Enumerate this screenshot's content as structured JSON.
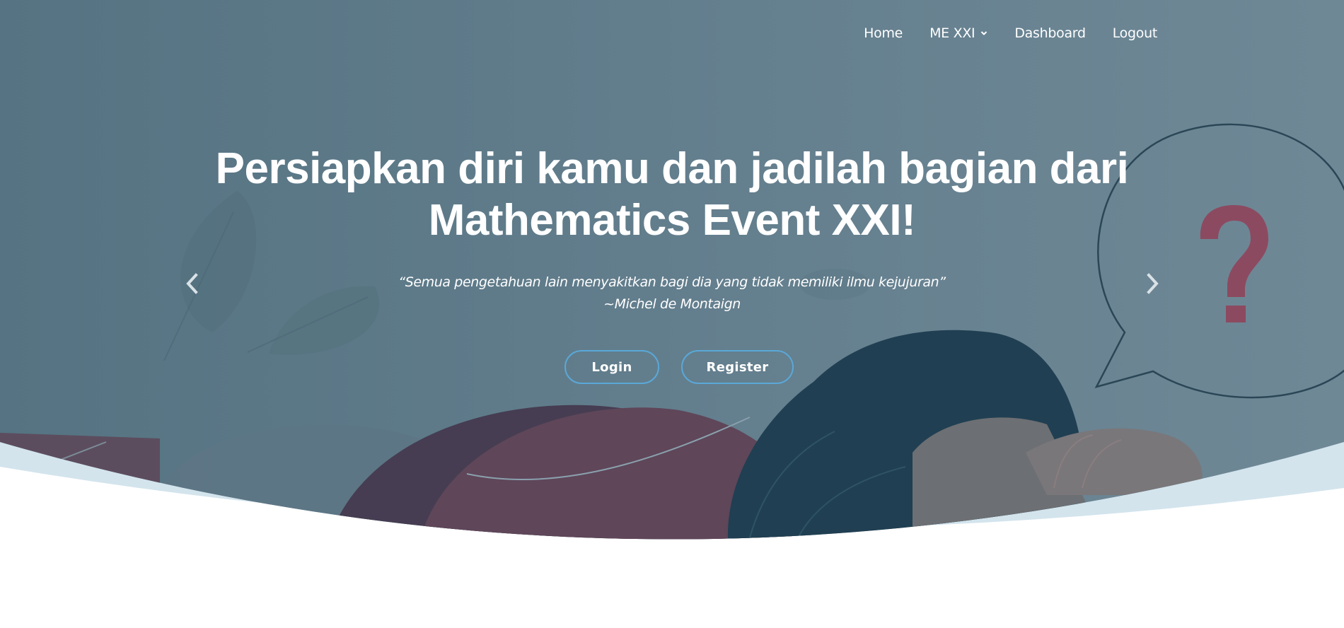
{
  "nav": {
    "items": [
      {
        "label": "Home"
      },
      {
        "label": "ME XXI",
        "has_dropdown": true
      },
      {
        "label": "Dashboard"
      },
      {
        "label": "Logout"
      }
    ]
  },
  "hero": {
    "headline_line1": "Persiapkan diri kamu dan jadilah bagian dari",
    "headline_line2": "Mathematics Event XXI!",
    "quote_line1": "“Semua pengetahuan lain menyakitkan bagi dia yang tidak memiliki ilmu kejujuran”",
    "quote_line2": "~Michel de Montaign",
    "login_label": "Login",
    "register_label": "Register",
    "prev_icon": "chevron-left-icon",
    "next_icon": "chevron-right-icon"
  },
  "colors": {
    "overlay": "#5f7c8d",
    "button_border": "#5aa8d8",
    "wave": "#d3e4ed",
    "question_mark": "#8c4a60"
  }
}
